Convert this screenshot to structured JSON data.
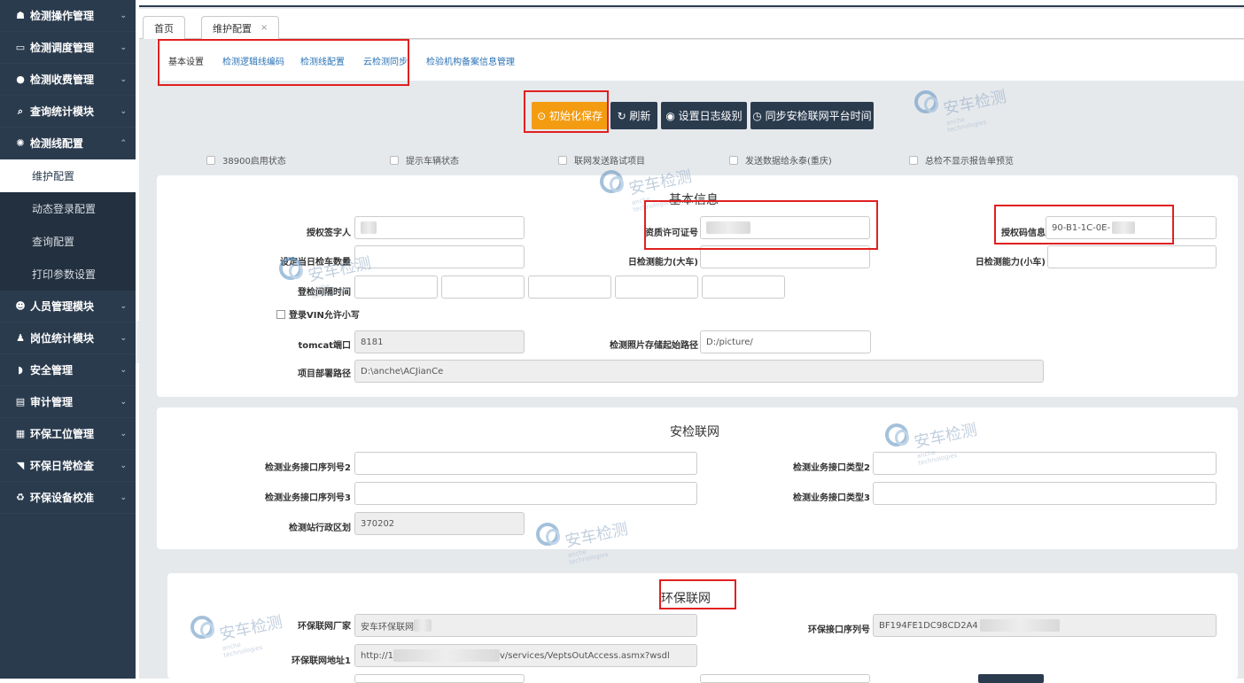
{
  "sidebar": {
    "items": [
      {
        "icon": "home-icon",
        "glyph": "☗",
        "label": "检测操作管理"
      },
      {
        "icon": "monitor-icon",
        "glyph": "▭",
        "label": "检测调度管理"
      },
      {
        "icon": "money-icon",
        "glyph": "●",
        "label": "检测收费管理"
      },
      {
        "icon": "search-icon",
        "glyph": "⌕",
        "label": "查询统计模块"
      },
      {
        "icon": "gear-icon",
        "glyph": "✺",
        "label": "检测线配置"
      },
      {
        "icon": "users-icon",
        "glyph": "☻",
        "label": "人员管理模块"
      },
      {
        "icon": "user-icon",
        "glyph": "♟",
        "label": "岗位统计模块"
      },
      {
        "icon": "shield-icon",
        "glyph": "◗",
        "label": "安全管理"
      },
      {
        "icon": "card-icon",
        "glyph": "▤",
        "label": "审计管理"
      },
      {
        "icon": "calendar-icon",
        "glyph": "▦",
        "label": "环保工位管理"
      },
      {
        "icon": "tag-icon",
        "glyph": "◥",
        "label": "环保日常检查"
      },
      {
        "icon": "recycle-icon",
        "glyph": "♻",
        "label": "环保设备校准"
      }
    ],
    "submenu": [
      "维护配置",
      "动态登录配置",
      "查询配置",
      "打印参数设置"
    ]
  },
  "tabs": {
    "home": "首页",
    "current": "维护配置",
    "close": "×"
  },
  "subtabs": [
    "基本设置",
    "检测逻辑线编码",
    "检测线配置",
    "云检测同步",
    "检验机构备案信息管理"
  ],
  "toolbar": {
    "init_save": "⊙ 初始化保存",
    "refresh": "↻ 刷新",
    "log_level": "◉ 设置日志级别",
    "sync_time": "◷ 同步安检联网平台时间"
  },
  "options": [
    "38900启用状态",
    "提示车辆状态",
    "联网发送路试项目",
    "发送数据给永泰(重庆)",
    "总检不显示报告单预览"
  ],
  "basic": {
    "title": "基本信息",
    "auth_signer": "授权签字人",
    "license_no": "资质许可证号",
    "auth_code": "授权码信息",
    "auth_code_value": "90-B1-1C-0E-",
    "daily_count": "设定当日检车数量",
    "cap_big": "日检测能力(大车)",
    "cap_small": "日检测能力(小车)",
    "interval": "登检间隔时间",
    "vin_lower": "登录VIN允许小写",
    "tomcat_label": "tomcat端口",
    "tomcat_value": "8181",
    "photo_label": "检测照片存储起始路径",
    "photo_value": "D:/picture/",
    "deploy_label": "项目部署路径",
    "deploy_value": "D:\\anche\\ACJianCe"
  },
  "safety": {
    "title": "安检联网",
    "seq2": "检测业务接口序列号2",
    "type2": "检测业务接口类型2",
    "seq3": "检测业务接口序列号3",
    "type3": "检测业务接口类型3",
    "region_label": "检测站行政区划",
    "region_value": "370202"
  },
  "env": {
    "title": "环保联网",
    "vendor_label": "环保联网厂家",
    "vendor_value": "安车环保联网",
    "serial_label": "环保接口序列号",
    "serial_value": "BF194FE1DC98CD2A4",
    "url_label": "环保联网地址1",
    "url_prefix": "http://1",
    "url_suffix": "v/services/VeptsOutAccess.asmx?wsdl"
  },
  "watermark": {
    "text": "安车检测",
    "sub": "anche technologies"
  }
}
